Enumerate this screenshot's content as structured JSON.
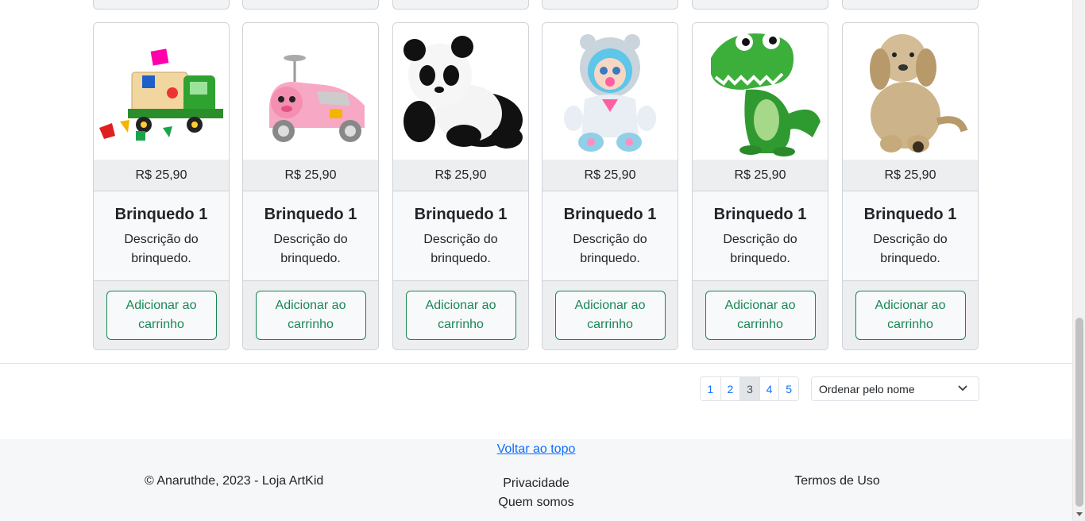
{
  "products": [
    {
      "image_icon": "shape-sorter-truck-toy-image",
      "price": "R$ 25,90",
      "title": "Brinquedo 1",
      "description": "Descrição do brinquedo.",
      "button_label": "Adicionar ao carrinho"
    },
    {
      "image_icon": "pink-ride-on-car-toy-image",
      "price": "R$ 25,90",
      "title": "Brinquedo 1",
      "description": "Descrição do brinquedo.",
      "button_label": "Adicionar ao carrinho"
    },
    {
      "image_icon": "panda-plush-toy-image",
      "price": "R$ 25,90",
      "title": "Brinquedo 1",
      "description": "Descrição do brinquedo.",
      "button_label": "Adicionar ao carrinho"
    },
    {
      "image_icon": "baby-doll-toy-image",
      "price": "R$ 25,90",
      "title": "Brinquedo 1",
      "description": "Descrição do brinquedo.",
      "button_label": "Adicionar ao carrinho"
    },
    {
      "image_icon": "green-dinosaur-toy-image",
      "price": "R$ 25,90",
      "title": "Brinquedo 1",
      "description": "Descrição do brinquedo.",
      "button_label": "Adicionar ao carrinho"
    },
    {
      "image_icon": "dog-plush-toy-image",
      "price": "R$ 25,90",
      "title": "Brinquedo 1",
      "description": "Descrição do brinquedo.",
      "button_label": "Adicionar ao carrinho"
    }
  ],
  "pagination": {
    "pages": [
      "1",
      "2",
      "3",
      "4",
      "5"
    ],
    "active_page": "3"
  },
  "sort": {
    "selected": "Ordenar pelo nome"
  },
  "footer": {
    "back_to_top": "Voltar ao topo",
    "copyright": "© Anaruthde, 2023 - Loja ArtKid",
    "privacy": "Privacidade",
    "about": "Quem somos",
    "terms": "Termos de Uso"
  },
  "colors": {
    "primary": "#0d6efd",
    "success": "#198754",
    "card_bg": "#f8f9fa",
    "footer_bg": "#f6f7f8"
  }
}
